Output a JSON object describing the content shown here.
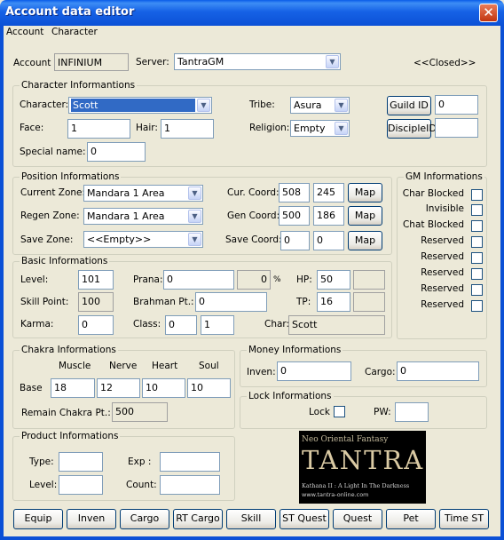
{
  "window": {
    "title": "Account data editor",
    "close_glyph": "✕"
  },
  "menu": [
    "Account",
    "Character"
  ],
  "account": {
    "label": "Account",
    "value": "INFINIUM",
    "server_label": "Server:",
    "server_value": "TantraGM",
    "status": "<<Closed>>"
  },
  "character_info": {
    "group_title": "Character Informantions",
    "character_label": "Character:",
    "character_value": "Scott",
    "tribe_label": "Tribe:",
    "tribe_value": "Asura",
    "guild_button": "Guild ID",
    "guild_value": "0",
    "face_label": "Face:",
    "face_value": "1",
    "hair_label": "Hair:",
    "hair_value": "1",
    "religion_label": "Religion:",
    "religion_value": "Empty",
    "disciple_button": "DiscipleID",
    "disciple_value": "",
    "special_label": "Special name:",
    "special_value": "0"
  },
  "position_info": {
    "group_title": "Position Informations",
    "cur_zone_label": "Current Zone:",
    "cur_zone_value": "Mandara 1 Area",
    "regen_zone_label": "Regen Zone:",
    "regen_zone_value": "Mandara 1 Area",
    "save_zone_label": "Save Zone:",
    "save_zone_value": "<<Empty>>",
    "cur_coord_label": "Cur. Coord:",
    "cur_x": "508",
    "cur_y": "245",
    "gen_coord_label": "Gen Coord:",
    "gen_x": "500",
    "gen_y": "186",
    "save_coord_label": "Save Coord:",
    "save_x": "0",
    "save_y": "0",
    "map_button": "Map"
  },
  "basic_info": {
    "group_title": "Basic Informations",
    "level_label": "Level:",
    "level_value": "101",
    "skill_label": "Skill Point:",
    "skill_value": "100",
    "karma_label": "Karma:",
    "karma_value": "0",
    "prana_label": "Prana:",
    "prana_value": "0",
    "prana_pct": "0",
    "pct_sign": "%",
    "brahman_label": "Brahman Pt.:",
    "brahman_value": "0",
    "class_label": "Class:",
    "class_value1": "0",
    "class_value2": "1",
    "hp_label": "HP:",
    "hp_value": "50",
    "hp_max": "",
    "tp_label": "TP:",
    "tp_value": "16",
    "tp_max": "",
    "char_label": "Char:",
    "char_value": "Scott"
  },
  "gm_info": {
    "group_title": "GM Informations",
    "items": [
      "Char Blocked",
      "Invisible",
      "Chat Blocked",
      "Reserved",
      "Reserved",
      "Reserved",
      "Reserved",
      "Reserved"
    ]
  },
  "chakra_info": {
    "group_title": "Chakra Informations",
    "headers": [
      "Muscle",
      "Nerve",
      "Heart",
      "Soul"
    ],
    "base_label": "Base",
    "values": [
      "18",
      "12",
      "10",
      "10"
    ],
    "remain_label": "Remain Chakra Pt.:",
    "remain_value": "500"
  },
  "money_info": {
    "group_title": "Money Informations",
    "inven_label": "Inven:",
    "inven_value": "0",
    "cargo_label": "Cargo:",
    "cargo_value": "0"
  },
  "lock_info": {
    "group_title": "Lock Informations",
    "lock_label": "Lock",
    "pw_label": "PW:",
    "pw_value": ""
  },
  "product_info": {
    "group_title": "Product Informations",
    "type_label": "Type:",
    "type_value": "",
    "exp_label": "Exp :",
    "exp_value": "",
    "level_label": "Level:",
    "level_value": "",
    "count_label": "Count:",
    "count_value": ""
  },
  "banner": {
    "tagline": "Neo Oriental Fantasy",
    "logo": "TANTRA",
    "subtitle": "Kathana II : A Light In The Darkness",
    "url": "www.tantra-online.com"
  },
  "buttons": [
    "Equip",
    "Inven",
    "Cargo",
    "RT Cargo",
    "Skill",
    "ST Quest",
    "Quest",
    "Pet",
    "Time ST"
  ]
}
